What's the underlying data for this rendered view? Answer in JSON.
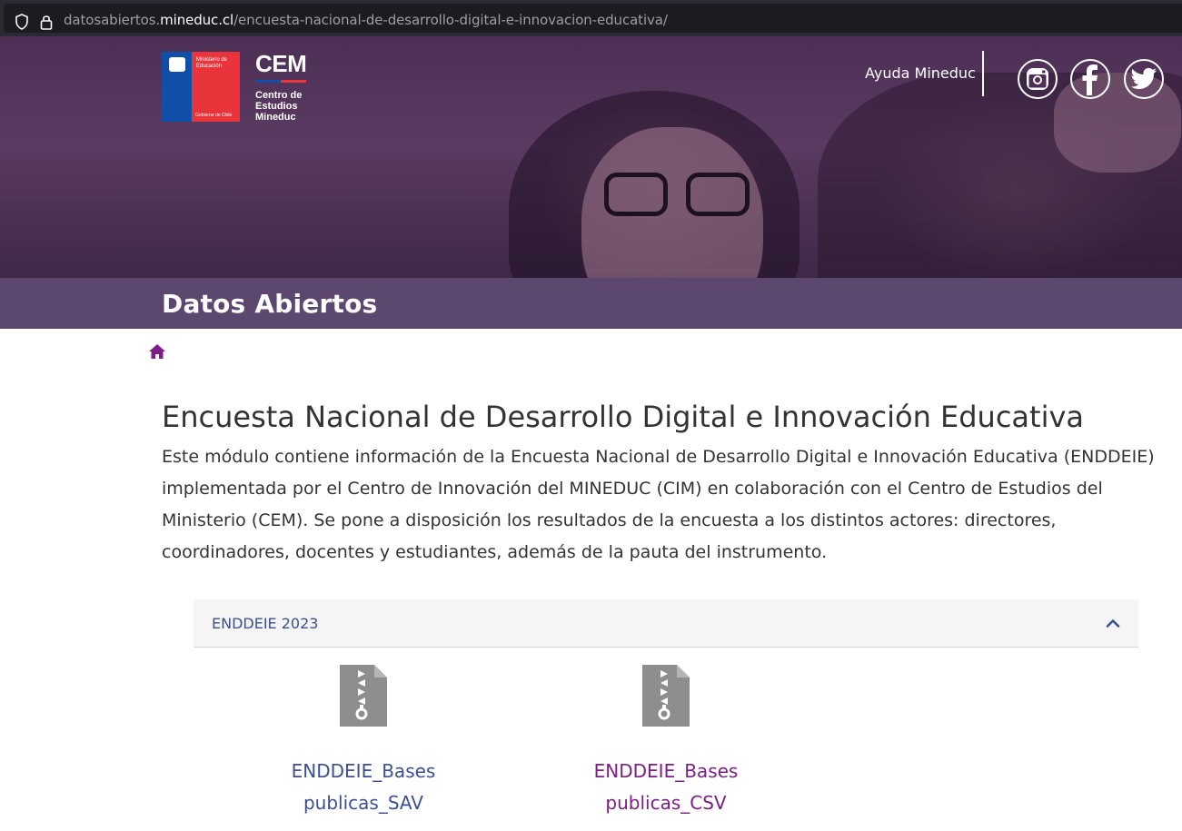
{
  "browser": {
    "url_prefix": "datosabiertos.",
    "url_domain": "mineduc.cl",
    "url_path": "/encuesta-nacional-de-desarrollo-digital-e-innovacion-educativa/"
  },
  "header": {
    "gov_logo_text": "Ministerio de Educación",
    "gov_logo_footer": "Gobierno de Chile",
    "cem_title": "CEM",
    "cem_subtitle": [
      "Centro de",
      "Estudios",
      "Mineduc"
    ],
    "help_link": "Ayuda Mineduc",
    "social": [
      "instagram-icon",
      "facebook-icon",
      "twitter-icon"
    ]
  },
  "band": {
    "title": "Datos Abiertos"
  },
  "breadcrumb": {
    "home_icon": "home-icon"
  },
  "main": {
    "title": "Encuesta Nacional de Desarrollo Digital e Innovación Educativa",
    "description": "Este módulo contiene información de la Encuesta Nacional de Desarrollo Digital e Innovación Educativa (ENDDEIE) implementada por el Centro de Innovación del MINEDUC (CIM) en colaboración con el Centro de Estudios del Ministerio (CEM). Se pone a disposición los resultados de la encuesta a los distintos actores: directores, coordinadores, docentes y estudiantes, además de la pauta del instrumento."
  },
  "accordion": {
    "label": "ENDDEIE 2023",
    "expanded": true,
    "files": [
      {
        "name_line1": "ENDDEIE_Bases",
        "name_line2": "publicas_SAV",
        "icon": "zip-file-icon"
      },
      {
        "name_line1": "ENDDEIE_Bases",
        "name_line2": "publicas_CSV",
        "icon": "zip-file-icon"
      }
    ]
  },
  "colors": {
    "band": "#5c476e",
    "link": "#3c4f93",
    "visited_link": "#7a1f86",
    "home_icon": "#7a1f86"
  }
}
